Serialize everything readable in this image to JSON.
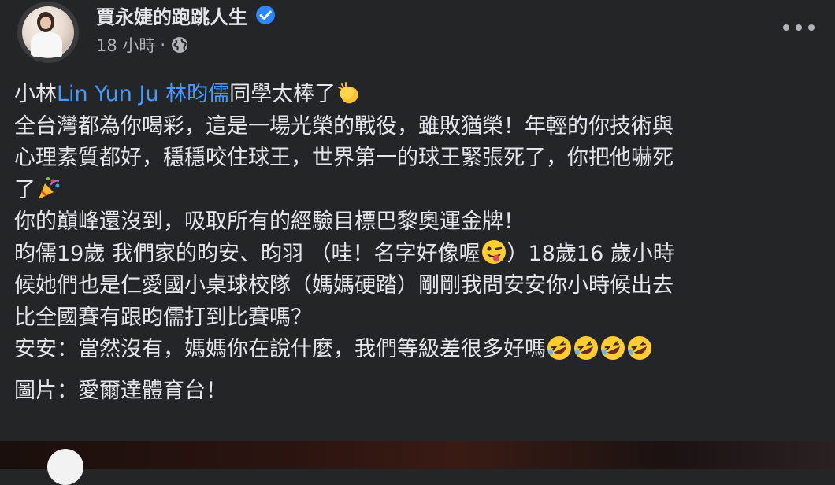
{
  "post": {
    "author": "賈永婕的跑跳人生",
    "time": "18 小時",
    "separator": "·",
    "verified_icon": "verified-badge-icon",
    "privacy_icon": "globe-icon",
    "lines": {
      "l1_pre": "小林",
      "l1_link": "Lin Yun Ju 林昀儒",
      "l1_post": "同學太棒了",
      "l2": "全台灣都為你喝彩，這是一場光榮的戰役，雖敗猶榮！年輕的你技術與",
      "l3": "心理素質都好，穩穩咬住球王，世界第一的球王緊張死了，你把他嚇死",
      "l4": "了",
      "l5": "你的巔峰還沒到，吸取所有的經驗目標巴黎奧運金牌！",
      "l6a": "昀儒19歲 我們家的昀安、昀羽 （哇！名字好像喔",
      "l6b": "）18歲16 歲小時",
      "l7": "候她們也是仁愛國小桌球校隊（媽媽硬踏）剛剛我問安安你小時候出去",
      "l8": "比全國賽有跟昀儒打到比賽嗎？",
      "l9": "安安：當然沒有，媽媽你在說什麼，我們等級差很多好嗎",
      "l10": "圖片：愛爾達體育台！"
    },
    "emojis": {
      "clap": "clapping-hands-emoji",
      "party": "party-popper-emoji",
      "wink": "winking-tongue-emoji",
      "laugh": "rolling-laughing-emoji"
    }
  }
}
